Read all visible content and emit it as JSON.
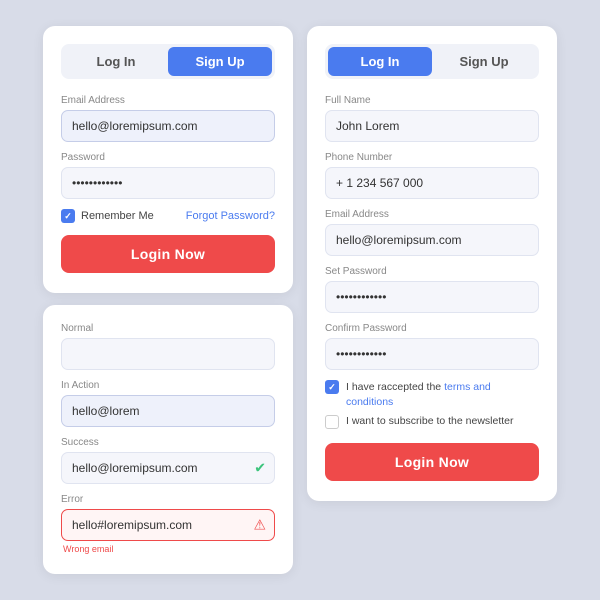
{
  "left_top": {
    "tab_login": "Log In",
    "tab_signup": "Sign Up",
    "tab_login_active": false,
    "tab_signup_active": true,
    "fields": [
      {
        "label": "Email Address",
        "value": "hello@loremipsum.com",
        "type": "text"
      },
      {
        "label": "Password",
        "value": "············",
        "type": "password"
      }
    ],
    "remember_label": "Remember Me",
    "forgot_label": "Forgot Password?",
    "login_btn": "Login Now"
  },
  "left_bottom": {
    "fields": [
      {
        "label": "Normal",
        "value": "",
        "state": "normal"
      },
      {
        "label": "In Action",
        "value": "hello@lorem",
        "state": "in-action"
      },
      {
        "label": "Success",
        "value": "hello@loremipsum.com",
        "state": "success"
      },
      {
        "label": "Error",
        "value": "hello#loremipsum.com",
        "state": "error"
      }
    ],
    "error_hint": "Wrong email"
  },
  "right": {
    "tab_login": "Log In",
    "tab_signup": "Sign Up",
    "fields": [
      {
        "label": "Full Name",
        "value": "John Lorem"
      },
      {
        "label": "Phone Number",
        "value": "+ 1 234 567 000"
      },
      {
        "label": "Email Address",
        "value": "hello@loremipsum.com"
      },
      {
        "label": "Set Password",
        "value": "············"
      },
      {
        "label": "Confirm Password",
        "value": "············"
      }
    ],
    "terms_text": "I have raccepted the ",
    "terms_link": "terms and conditions",
    "newsletter_text": "I want to subscribe to the newsletter",
    "login_btn": "Login Now"
  }
}
